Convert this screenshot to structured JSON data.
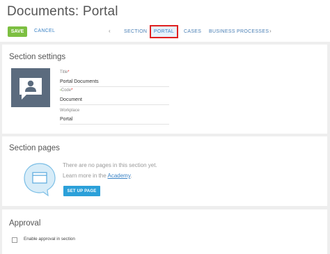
{
  "header": {
    "title": "Documents: Portal",
    "save_label": "SAVE",
    "cancel_label": "CANCEL",
    "prev_arrow": "‹",
    "next_arrow": "›",
    "tabs": [
      {
        "label": "SECTION",
        "active": false
      },
      {
        "label": "PORTAL",
        "active": true
      },
      {
        "label": "CASES",
        "active": false
      },
      {
        "label": "BUSINESS PROCESSES",
        "active": false
      }
    ]
  },
  "settings": {
    "title": "Section settings",
    "icon": "comment-user-icon",
    "fields": [
      {
        "label": "Title",
        "required": true,
        "value": "Portal Documents"
      },
      {
        "label": "Code",
        "required": true,
        "value": "Document"
      },
      {
        "label": "Workplace",
        "required": false,
        "value": "Portal"
      }
    ]
  },
  "pages": {
    "title": "Section pages",
    "empty_text": "There are no pages in this section yet.",
    "learn_prefix": "Learn more in the ",
    "learn_link": "Academy",
    "learn_suffix": ".",
    "setup_label": "SET UP PAGE",
    "icon": "window-bubble-icon"
  },
  "approval": {
    "title": "Approval",
    "checkbox_label": "Enable approval in section",
    "checked": false
  },
  "colors": {
    "save": "#7cbf41",
    "link": "#3b83c6",
    "setup_button": "#2ba0d9",
    "highlight_border": "#e02020",
    "icon_tile": "#5b6b7e"
  }
}
